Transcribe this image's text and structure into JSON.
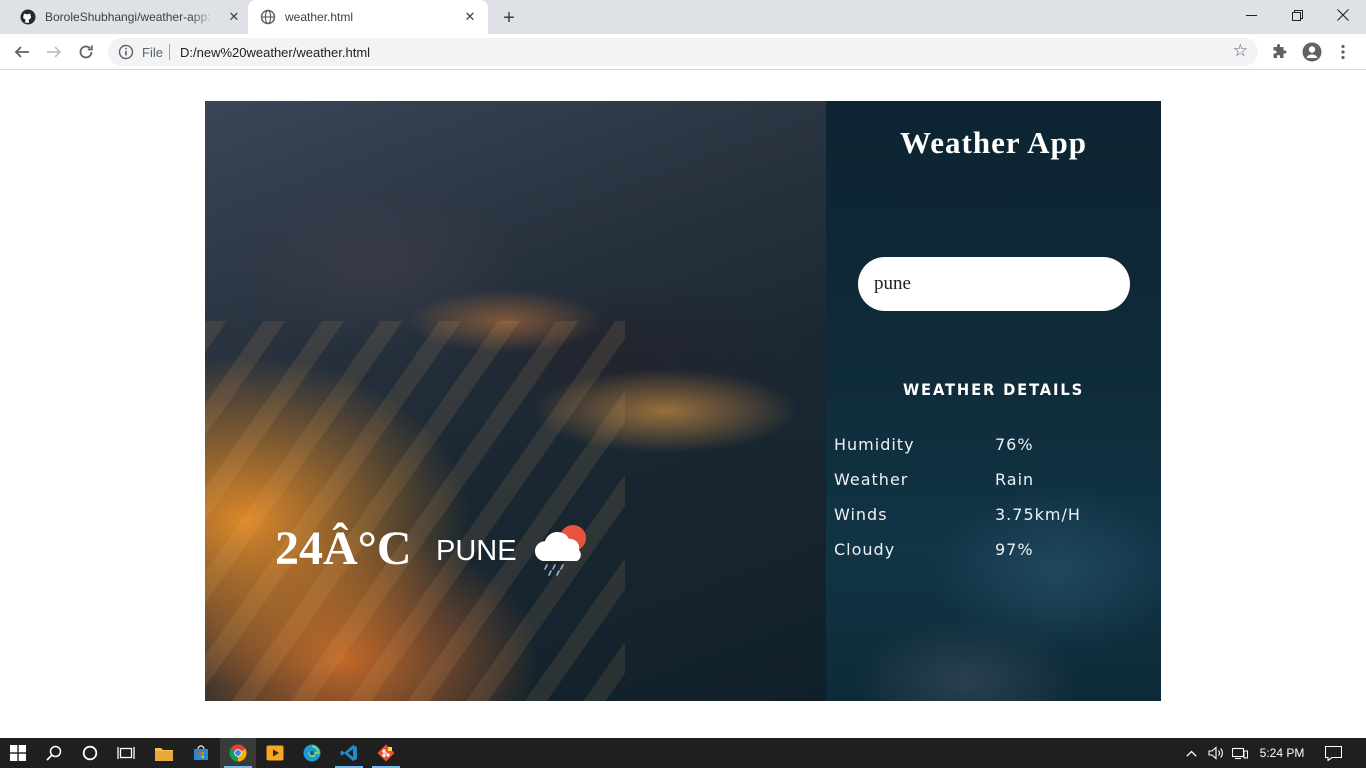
{
  "browser": {
    "tabs": [
      {
        "title": "BoroleShubhangi/weather-app: A",
        "icon": "github-icon",
        "active": false
      },
      {
        "title": "weather.html",
        "icon": "globe-icon",
        "active": true
      }
    ],
    "omnibox": {
      "scheme_label": "File",
      "url": "D:/new%20weather/weather.html"
    }
  },
  "app": {
    "title": "Weather App",
    "search": {
      "value": "pune",
      "placeholder": ""
    },
    "details_heading": "WEATHER DETAILS",
    "details": [
      {
        "label": "Humidity",
        "value": "76%"
      },
      {
        "label": "Weather",
        "value": "Rain"
      },
      {
        "label": "Winds",
        "value": "3.75km/H"
      },
      {
        "label": "Cloudy",
        "value": "97%"
      }
    ],
    "current": {
      "temperature": "24Â°C",
      "city": "PUNE",
      "icon": "rain-cloud-sun-icon"
    }
  },
  "taskbar": {
    "clock": "5:24 PM",
    "apps": [
      "start-icon",
      "search-icon",
      "cortana-icon",
      "task-view-icon",
      "file-explorer-icon",
      "store-icon",
      "chrome-icon",
      "media-icon",
      "edge-icon",
      "vscode-icon",
      "git-icon"
    ]
  },
  "colors": {
    "panel": "#0f2a38",
    "input_bg": "#ffffff",
    "taskbar": "#1f1f1f",
    "accent": "#76b9ed"
  }
}
